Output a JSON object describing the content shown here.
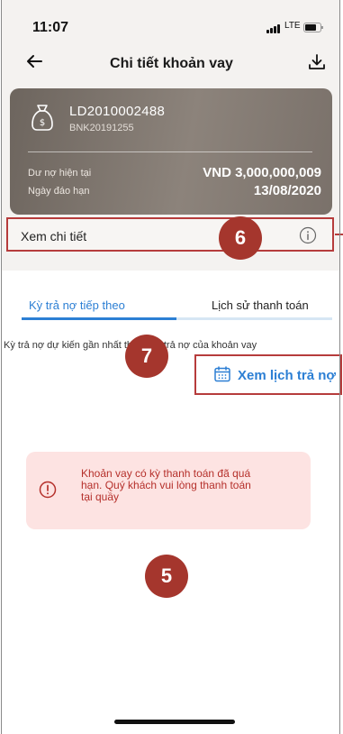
{
  "status_bar": {
    "time": "11:07",
    "network": "LTE"
  },
  "header": {
    "title": "Chi tiết khoản vay",
    "back_icon": "arrow-left-icon",
    "download_icon": "download-icon"
  },
  "loan_card": {
    "account_number": "LD2010002488",
    "reference": "BNK20191255",
    "outstanding_label": "Dư nợ hiện tại",
    "outstanding_value": "VND 3,000,000,009",
    "due_date_label": "Ngày đáo hạn",
    "due_date_value": "13/08/2020"
  },
  "details_row": {
    "label": "Xem chi tiết",
    "icon": "info-icon"
  },
  "tabs": [
    {
      "label": "Kỳ trả nợ tiếp theo",
      "active": true
    },
    {
      "label": "Lịch sử thanh toán",
      "active": false
    }
  ],
  "next_payment": {
    "description": "Kỳ trả nợ dự kiến gần nhất theo lịch trả nợ của khoản vay",
    "schedule_link": "Xem lịch trả nợ"
  },
  "alert": {
    "line1": "Khoản vay có kỳ thanh toán đã quá",
    "line2": "hạn. Quý khách vui lòng thanh toán",
    "line3": "tại quầy"
  },
  "annotations": {
    "marker_5": "5",
    "marker_6": "6",
    "marker_7": "7"
  },
  "colors": {
    "accent_blue": "#2c7fd4",
    "annotation_red": "#a5362d",
    "alert_bg": "#fde3e2",
    "alert_text": "#b5302b"
  }
}
